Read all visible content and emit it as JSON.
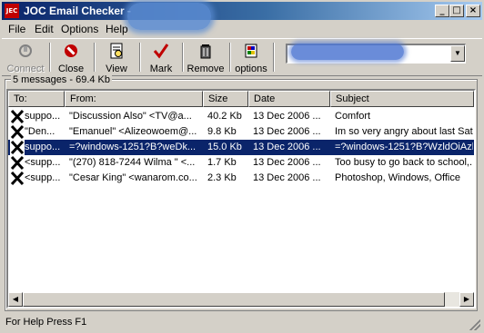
{
  "window": {
    "title": "JOC Email Checker -",
    "app_icon": "JEC"
  },
  "title_buttons": {
    "minimize": "_",
    "maximize": "□",
    "close": "×"
  },
  "menu": {
    "file": "File",
    "edit": "Edit",
    "options": "Options",
    "help": "Help"
  },
  "toolbar": {
    "connect": "Connect",
    "close": "Close",
    "view": "View",
    "mark": "Mark",
    "remove": "Remove",
    "options": "options",
    "account_value": "",
    "colors": {
      "close": "#c00000",
      "mark": "#c00000"
    }
  },
  "summary": "5 messages - 69.4 Kb",
  "columns": {
    "to": "To:",
    "from": "From:",
    "size": "Size",
    "date": "Date",
    "subject": "Subject"
  },
  "rows": [
    {
      "to": "suppo...",
      "from": "\"Discussion Also\" <TV@a...",
      "size": "40.2 Kb",
      "date": "13 Dec 2006 ...",
      "subject": "Comfort"
    },
    {
      "to": "\"Den...",
      "from": "\"Emanuel\" <Alizeowoem@...",
      "size": "9.8 Kb",
      "date": "13 Dec 2006 ...",
      "subject": "Im so very angry about last Sat..."
    },
    {
      "to": "suppo...",
      "from": "=?windows-1251?B?weDk...",
      "size": "15.0 Kb",
      "date": "13 Dec 2006 ...",
      "subject": "=?windows-1251?B?WzldOiAzl..."
    },
    {
      "to": "<supp...",
      "from": "\"(270) 818-7244 Wilma \" <...",
      "size": "1.7 Kb",
      "date": "13 Dec 2006 ...",
      "subject": "Too busy to go back to school,..."
    },
    {
      "to": "<supp...",
      "from": "\"Cesar King\" <wanarom.co...",
      "size": "2.3 Kb",
      "date": "13 Dec 2006 ...",
      "subject": "Photoshop, Windows, Office"
    }
  ],
  "selected_row": 2,
  "status": "For Help Press F1"
}
